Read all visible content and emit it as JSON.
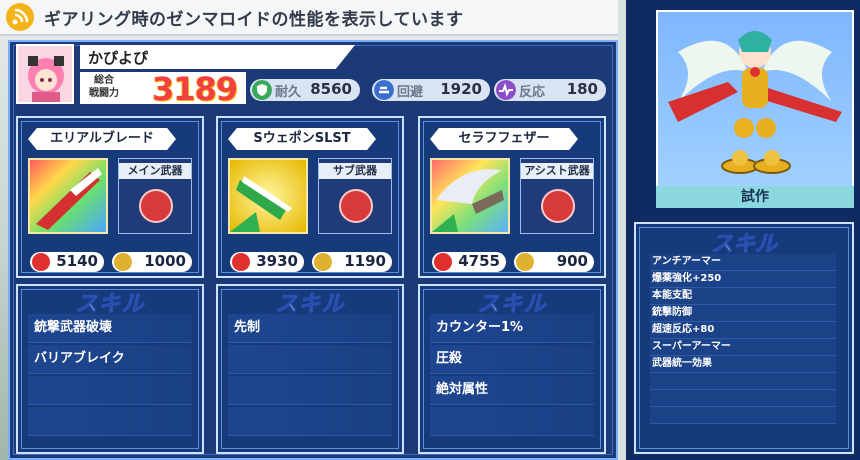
{
  "header": {
    "title": "ギアリング時のゼンマロイドの性能を表示しています"
  },
  "player": {
    "name": "かぴよぴ",
    "power_label_line1": "総合",
    "power_label_line2": "戦闘力",
    "power_value": "3189"
  },
  "stats": [
    {
      "label": "耐久",
      "value": "8560",
      "icon": "shield-icon",
      "color": "#3aa85a"
    },
    {
      "label": "回避",
      "value": "1920",
      "icon": "dodge-icon",
      "color": "#3a6fd0"
    },
    {
      "label": "反応",
      "value": "180",
      "icon": "pulse-icon",
      "color": "#8a4fc8"
    }
  ],
  "weapons": [
    {
      "name": "エリアルブレード",
      "type": "メイン武器",
      "attack": "5140",
      "coin": "1000"
    },
    {
      "name": "SウェポンSLST",
      "type": "サブ武器",
      "attack": "3930",
      "coin": "1190"
    },
    {
      "name": "セラフフェザー",
      "type": "アシスト武器",
      "attack": "4755",
      "coin": "900"
    }
  ],
  "skill_title": "スキル",
  "weapon_skills": [
    [
      "銃撃武器破壊",
      "バリアブレイク",
      "",
      ""
    ],
    [
      "先制",
      "",
      "",
      ""
    ],
    [
      "カウンター1%",
      "圧殺",
      "絶対属性",
      ""
    ]
  ],
  "mech": {
    "tag": "試作",
    "skills": [
      "アンチアーマー",
      "爆薬強化+250",
      "本能支配",
      "銃撃防御",
      "超速反応+80",
      "スーパーアーマー",
      "武器統一効果",
      "",
      "",
      ""
    ]
  }
}
